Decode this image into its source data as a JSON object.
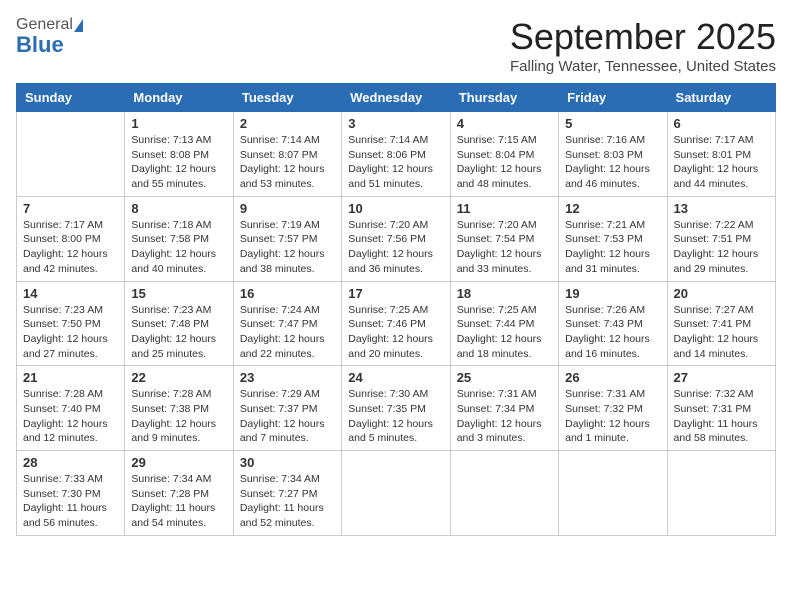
{
  "logo": {
    "general": "General",
    "blue": "Blue"
  },
  "title": "September 2025",
  "location": "Falling Water, Tennessee, United States",
  "weekdays": [
    "Sunday",
    "Monday",
    "Tuesday",
    "Wednesday",
    "Thursday",
    "Friday",
    "Saturday"
  ],
  "weeks": [
    [
      {
        "day": "",
        "text": ""
      },
      {
        "day": "1",
        "text": "Sunrise: 7:13 AM\nSunset: 8:08 PM\nDaylight: 12 hours\nand 55 minutes."
      },
      {
        "day": "2",
        "text": "Sunrise: 7:14 AM\nSunset: 8:07 PM\nDaylight: 12 hours\nand 53 minutes."
      },
      {
        "day": "3",
        "text": "Sunrise: 7:14 AM\nSunset: 8:06 PM\nDaylight: 12 hours\nand 51 minutes."
      },
      {
        "day": "4",
        "text": "Sunrise: 7:15 AM\nSunset: 8:04 PM\nDaylight: 12 hours\nand 48 minutes."
      },
      {
        "day": "5",
        "text": "Sunrise: 7:16 AM\nSunset: 8:03 PM\nDaylight: 12 hours\nand 46 minutes."
      },
      {
        "day": "6",
        "text": "Sunrise: 7:17 AM\nSunset: 8:01 PM\nDaylight: 12 hours\nand 44 minutes."
      }
    ],
    [
      {
        "day": "7",
        "text": "Sunrise: 7:17 AM\nSunset: 8:00 PM\nDaylight: 12 hours\nand 42 minutes."
      },
      {
        "day": "8",
        "text": "Sunrise: 7:18 AM\nSunset: 7:58 PM\nDaylight: 12 hours\nand 40 minutes."
      },
      {
        "day": "9",
        "text": "Sunrise: 7:19 AM\nSunset: 7:57 PM\nDaylight: 12 hours\nand 38 minutes."
      },
      {
        "day": "10",
        "text": "Sunrise: 7:20 AM\nSunset: 7:56 PM\nDaylight: 12 hours\nand 36 minutes."
      },
      {
        "day": "11",
        "text": "Sunrise: 7:20 AM\nSunset: 7:54 PM\nDaylight: 12 hours\nand 33 minutes."
      },
      {
        "day": "12",
        "text": "Sunrise: 7:21 AM\nSunset: 7:53 PM\nDaylight: 12 hours\nand 31 minutes."
      },
      {
        "day": "13",
        "text": "Sunrise: 7:22 AM\nSunset: 7:51 PM\nDaylight: 12 hours\nand 29 minutes."
      }
    ],
    [
      {
        "day": "14",
        "text": "Sunrise: 7:23 AM\nSunset: 7:50 PM\nDaylight: 12 hours\nand 27 minutes."
      },
      {
        "day": "15",
        "text": "Sunrise: 7:23 AM\nSunset: 7:48 PM\nDaylight: 12 hours\nand 25 minutes."
      },
      {
        "day": "16",
        "text": "Sunrise: 7:24 AM\nSunset: 7:47 PM\nDaylight: 12 hours\nand 22 minutes."
      },
      {
        "day": "17",
        "text": "Sunrise: 7:25 AM\nSunset: 7:46 PM\nDaylight: 12 hours\nand 20 minutes."
      },
      {
        "day": "18",
        "text": "Sunrise: 7:25 AM\nSunset: 7:44 PM\nDaylight: 12 hours\nand 18 minutes."
      },
      {
        "day": "19",
        "text": "Sunrise: 7:26 AM\nSunset: 7:43 PM\nDaylight: 12 hours\nand 16 minutes."
      },
      {
        "day": "20",
        "text": "Sunrise: 7:27 AM\nSunset: 7:41 PM\nDaylight: 12 hours\nand 14 minutes."
      }
    ],
    [
      {
        "day": "21",
        "text": "Sunrise: 7:28 AM\nSunset: 7:40 PM\nDaylight: 12 hours\nand 12 minutes."
      },
      {
        "day": "22",
        "text": "Sunrise: 7:28 AM\nSunset: 7:38 PM\nDaylight: 12 hours\nand 9 minutes."
      },
      {
        "day": "23",
        "text": "Sunrise: 7:29 AM\nSunset: 7:37 PM\nDaylight: 12 hours\nand 7 minutes."
      },
      {
        "day": "24",
        "text": "Sunrise: 7:30 AM\nSunset: 7:35 PM\nDaylight: 12 hours\nand 5 minutes."
      },
      {
        "day": "25",
        "text": "Sunrise: 7:31 AM\nSunset: 7:34 PM\nDaylight: 12 hours\nand 3 minutes."
      },
      {
        "day": "26",
        "text": "Sunrise: 7:31 AM\nSunset: 7:32 PM\nDaylight: 12 hours\nand 1 minute."
      },
      {
        "day": "27",
        "text": "Sunrise: 7:32 AM\nSunset: 7:31 PM\nDaylight: 11 hours\nand 58 minutes."
      }
    ],
    [
      {
        "day": "28",
        "text": "Sunrise: 7:33 AM\nSunset: 7:30 PM\nDaylight: 11 hours\nand 56 minutes."
      },
      {
        "day": "29",
        "text": "Sunrise: 7:34 AM\nSunset: 7:28 PM\nDaylight: 11 hours\nand 54 minutes."
      },
      {
        "day": "30",
        "text": "Sunrise: 7:34 AM\nSunset: 7:27 PM\nDaylight: 11 hours\nand 52 minutes."
      },
      {
        "day": "",
        "text": ""
      },
      {
        "day": "",
        "text": ""
      },
      {
        "day": "",
        "text": ""
      },
      {
        "day": "",
        "text": ""
      }
    ]
  ]
}
